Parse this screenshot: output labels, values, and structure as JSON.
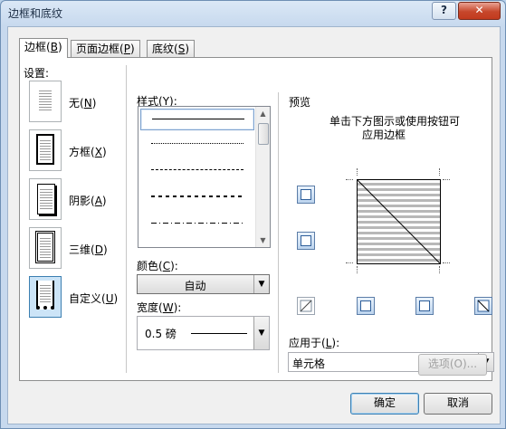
{
  "window": {
    "title": "边框和底纹",
    "help_glyph": "?",
    "close_glyph": "✕"
  },
  "tabs": [
    {
      "label": "边框",
      "accel": "B"
    },
    {
      "label": "页面边框",
      "accel": "P"
    },
    {
      "label": "底纹",
      "accel": "S"
    }
  ],
  "settings": {
    "heading": "设置:",
    "items": [
      {
        "label": "无",
        "accel": "N"
      },
      {
        "label": "方框",
        "accel": "X"
      },
      {
        "label": "阴影",
        "accel": "A"
      },
      {
        "label": "三维",
        "accel": "D"
      },
      {
        "label": "自定义",
        "accel": "U"
      }
    ]
  },
  "style": {
    "label": "样式",
    "accel": "Y",
    "colon": ":"
  },
  "color": {
    "label": "颜色",
    "accel": "C",
    "colon": ":",
    "value": "自动"
  },
  "width": {
    "label": "宽度",
    "accel": "W",
    "colon": ":",
    "value": "0.5 磅"
  },
  "preview": {
    "heading": "预览",
    "hint_line1": "单击下方图示或使用按钮可",
    "hint_line2": "应用边框"
  },
  "apply_to": {
    "label": "应用于",
    "accel": "L",
    "colon": ":",
    "value": "单元格"
  },
  "buttons": {
    "options": "选项(O)...",
    "ok": "确定",
    "cancel": "取消"
  },
  "icons": {
    "dropdown": "▼",
    "scroll_up": "▲",
    "scroll_down": "▼"
  }
}
